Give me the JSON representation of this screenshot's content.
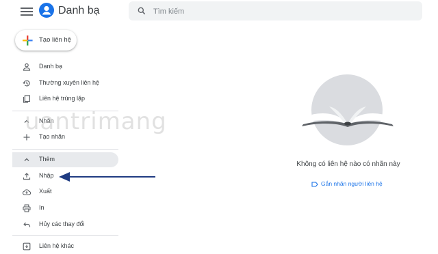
{
  "header": {
    "app_title": "Danh bạ",
    "search_placeholder": "Tìm kiếm"
  },
  "create_button": {
    "label": "Tạo liên hệ"
  },
  "sidebar": {
    "items": [
      {
        "label": "Danh bạ",
        "icon": "person-icon"
      },
      {
        "label": "Thường xuyên liên hệ",
        "icon": "history-icon"
      },
      {
        "label": "Liên hệ trùng lặp",
        "icon": "copy-icon"
      },
      {
        "label": "Nhãn",
        "icon": "chevron-up-icon"
      },
      {
        "label": "Tạo nhãn",
        "icon": "plus-icon"
      },
      {
        "label": "Thêm",
        "icon": "chevron-up-icon"
      },
      {
        "label": "Nhập",
        "icon": "upload-icon"
      },
      {
        "label": "Xuất",
        "icon": "cloud-download-icon"
      },
      {
        "label": "In",
        "icon": "print-icon"
      },
      {
        "label": "Hủy các thay đổi",
        "icon": "undo-icon"
      },
      {
        "label": "Liên hệ khác",
        "icon": "archive-icon"
      }
    ]
  },
  "watermark": {
    "text": "uantrimang"
  },
  "empty_state": {
    "message": "Không có liên hệ nào có nhãn này",
    "action_label": "Gắn nhãn người liên hệ"
  },
  "colors": {
    "accent": "#1a73e8",
    "arrow": "#1f3b82",
    "active_bg": "#e8eaed"
  }
}
